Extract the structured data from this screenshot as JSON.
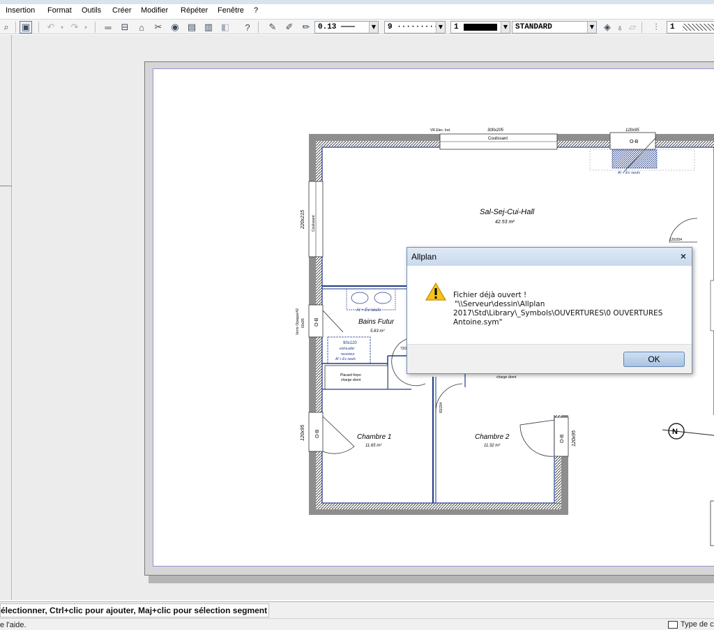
{
  "menu": {
    "items": [
      {
        "label": "Insertion"
      },
      {
        "label": "Format"
      },
      {
        "label": "Outils"
      },
      {
        "label": "Créer"
      },
      {
        "label": "Modifier"
      },
      {
        "label": "Répéter"
      },
      {
        "label": "Fenêtre"
      },
      {
        "label": "?"
      }
    ]
  },
  "toolbar": {
    "pen_thickness": "0.13 ———",
    "line_type": "9 ··········",
    "color_number": "1",
    "layer": "STANDARD",
    "pattern_number": "1"
  },
  "drawing": {
    "labels": {
      "window_top": "300x205",
      "window_top_label": "Coulissant",
      "window_top_note": "VR Elec. Ind.",
      "window_tr": "120x95",
      "window_tr_label": "O-B",
      "room_main_name": "Sal-Sej-Cui-Hall",
      "room_main_area": "42.53 m²",
      "room_bath_name": "Bains Futur",
      "room_bath_area": "5.63 m²",
      "room_ch1_name": "Chambre 1",
      "room_ch1_area": "11.65 m²",
      "room_ch2_name": "Chambre 2",
      "room_ch2_area": "11.32 m²",
      "placard": "Placard  forpo",
      "placard2": "charge client",
      "charge_client": "charge client",
      "shower": "90x120",
      "shower2": "extra-plat",
      "shower3": "receveur",
      "shower4": "Al + Ev seuls",
      "al_ev": "Al + Ev seuls",
      "al_ev_tr": "Al + Ev seuls",
      "left_window": "220x215",
      "left_window_label": "Coulissant",
      "ob_left_upper": "O-B",
      "left_upper_dim": "Verre Opaque/42",
      "left_upper_dim2": "60x95",
      "ob_left_lower": "O-B",
      "left_lower_dim": "120x95",
      "ob_right_lower": "O-B",
      "right_lower_dim": "120x95",
      "door_label": "120/204",
      "door_label2": "73/204",
      "door_label3": "83/204"
    }
  },
  "dialog": {
    "title": "Allplan",
    "close_label": "×",
    "line1": "Fichier déjà ouvert !",
    "line2": "\"\\\\Serveur\\dessin\\Allplan",
    "line3": "2017\\Std\\Library\\_Symbols\\OUVERTURES\\0  OUVERTURES",
    "line4": "Antoine.sym\"",
    "ok_label": "OK"
  },
  "status": {
    "message": "électionner, Ctrl+clic pour ajouter, Maj+clic pour sélection segment",
    "help": "e l'aide.",
    "type_label": "Type de c"
  },
  "colors": {
    "accent": "#1e3a8a",
    "dialog_border": "#6f8fb5",
    "paper_border": "#9a8ed8"
  }
}
